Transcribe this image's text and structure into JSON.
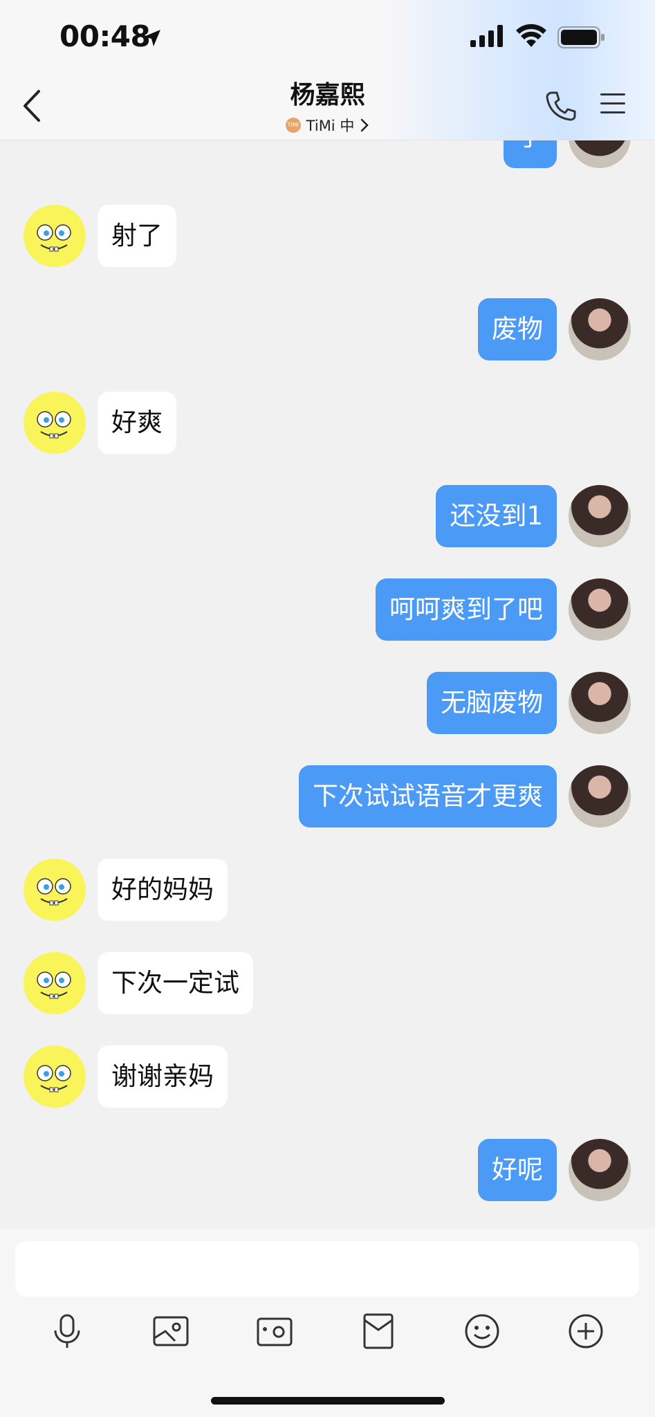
{
  "status": {
    "time": "00:48"
  },
  "header": {
    "title": "杨嘉熙",
    "subtitle_app": "TiMi 中",
    "logo_text": "TiMi"
  },
  "messages": [
    {
      "side": "right",
      "text": "了"
    },
    {
      "side": "left",
      "text": "射了"
    },
    {
      "side": "right",
      "text": "废物"
    },
    {
      "side": "left",
      "text": "好爽"
    },
    {
      "side": "right",
      "text": "还没到1"
    },
    {
      "side": "right",
      "text": "呵呵爽到了吧"
    },
    {
      "side": "right",
      "text": "无脑废物"
    },
    {
      "side": "right",
      "text": "下次试试语音才更爽"
    },
    {
      "side": "left",
      "text": "好的妈妈"
    },
    {
      "side": "left",
      "text": "下次一定试"
    },
    {
      "side": "left",
      "text": "谢谢亲妈"
    },
    {
      "side": "right",
      "text": "好呢"
    }
  ],
  "toolbar": {
    "icons": [
      "microphone-icon",
      "image-icon",
      "camera-icon",
      "red-packet-icon",
      "emoji-icon",
      "plus-icon"
    ]
  },
  "colors": {
    "sent_bubble": "#4a9af6",
    "received_bubble": "#ffffff",
    "background": "#f1f1f2"
  }
}
